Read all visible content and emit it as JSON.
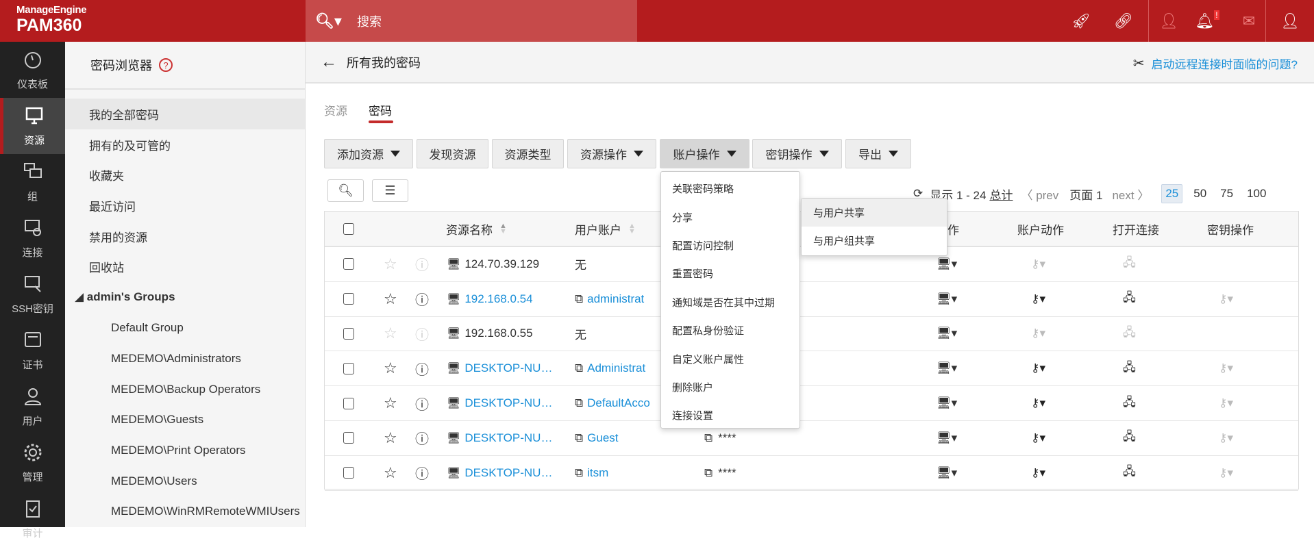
{
  "header": {
    "brand": "ManageEngine",
    "product": "PAM360",
    "search_label": "搜索"
  },
  "rail": [
    {
      "label": "仪表板",
      "icon": "dashboard-icon"
    },
    {
      "label": "资源",
      "icon": "monitor-icon",
      "active": true
    },
    {
      "label": "组",
      "icon": "group-icon"
    },
    {
      "label": "连接",
      "icon": "connection-icon"
    },
    {
      "label": "SSH密钥",
      "icon": "ssh-key-icon"
    },
    {
      "label": "证书",
      "icon": "certificate-icon"
    },
    {
      "label": "用户",
      "icon": "user-icon"
    },
    {
      "label": "管理",
      "icon": "gear-icon"
    },
    {
      "label": "审计",
      "icon": "audit-icon"
    }
  ],
  "sidebar": {
    "title": "密码浏览器",
    "help": "?",
    "items": [
      {
        "label": "我的全部密码",
        "type": "sel"
      },
      {
        "label": "拥有的及可管的"
      },
      {
        "label": "收藏夹"
      },
      {
        "label": "最近访问"
      },
      {
        "label": "禁用的资源"
      },
      {
        "label": "回收站"
      },
      {
        "label": "◢ admin's Groups",
        "type": "grp"
      },
      {
        "label": "Default Group",
        "type": "sub"
      },
      {
        "label": "MEDEMO\\Administrators",
        "type": "sub"
      },
      {
        "label": "MEDEMO\\Backup Operators",
        "type": "sub"
      },
      {
        "label": "MEDEMO\\Guests",
        "type": "sub"
      },
      {
        "label": "MEDEMO\\Print Operators",
        "type": "sub"
      },
      {
        "label": "MEDEMO\\Users",
        "type": "sub"
      },
      {
        "label": "MEDEMO\\WinRMRemoteWMIUsers",
        "type": "sub"
      }
    ]
  },
  "main": {
    "title": "所有我的密码",
    "help_link": "启动远程连接时面临的问题?",
    "tabs": [
      "资源",
      "密码"
    ],
    "toolbar": [
      "添加资源",
      "发现资源",
      "资源类型",
      "资源操作",
      "账户操作",
      "密钥操作",
      "导出"
    ],
    "pager": {
      "showing": "显示 1 - 24",
      "total": "总计",
      "prev": "prev",
      "page": "页面 1",
      "next": "next",
      "sizes": [
        "25",
        "50",
        "75",
        "100"
      ],
      "selected_size": "25"
    },
    "columns": {
      "name": "资源名称",
      "account": "用户账户",
      "res_action": "资源动作",
      "acct_action": "账户动作",
      "open_conn": "打开连接",
      "key_op": "密钥操作"
    },
    "rows": [
      {
        "name": "124.70.39.129",
        "account": "无",
        "password": "",
        "enabled": false,
        "link": false
      },
      {
        "name": "192.168.0.54",
        "account": "administrat",
        "password": "",
        "enabled": true,
        "link": true
      },
      {
        "name": "192.168.0.55",
        "account": "无",
        "password": "",
        "enabled": false,
        "link": false
      },
      {
        "name": "DESKTOP-NU…",
        "account": "Administrat",
        "password": "",
        "enabled": true,
        "link": true
      },
      {
        "name": "DESKTOP-NU…",
        "account": "DefaultAcco",
        "password": "",
        "enabled": true,
        "link": true
      },
      {
        "name": "DESKTOP-NU…",
        "account": "Guest",
        "password": "****",
        "enabled": true,
        "link": true
      },
      {
        "name": "DESKTOP-NU…",
        "account": "itsm",
        "password": "****",
        "enabled": true,
        "link": true
      }
    ]
  },
  "account_menu": [
    "关联密码策略",
    "分享",
    "配置访问控制",
    "重置密码",
    "通知域是否在其中过期",
    "配置私身份验证",
    "自定义账户属性",
    "删除账户",
    "连接设置"
  ],
  "share_submenu": [
    "与用户共享",
    "与用户组共享"
  ],
  "colors": {
    "header": "#b41c1e",
    "search": "#c64a4a",
    "link": "#1a8fd8",
    "rail": "#222222"
  }
}
